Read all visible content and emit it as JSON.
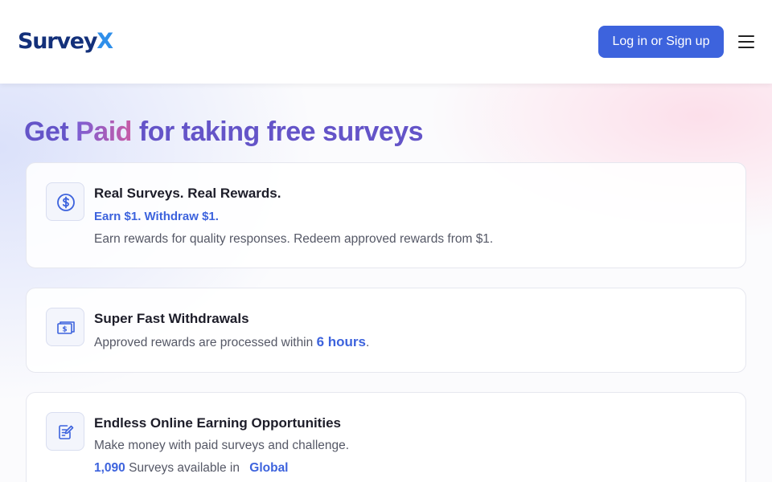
{
  "header": {
    "logo_main": "Survey",
    "logo_x": "X",
    "login_label": "Log in or Sign up",
    "menu_icon": "hamburger-menu-icon"
  },
  "hero": {
    "headline_prefix": "Get ",
    "headline_highlight": "Paid",
    "headline_suffix": " for taking free surveys"
  },
  "cards": [
    {
      "icon": "dollar-coin-icon",
      "title": "Real Surveys. Real Rewards.",
      "subtitle": "Earn $1. Withdraw $1.",
      "text": "Earn rewards for quality responses. Redeem approved rewards from $1."
    },
    {
      "icon": "banknote-icon",
      "title": "Super Fast Withdrawals",
      "text_prefix": "Approved rewards are processed within ",
      "text_highlight": "6 hours",
      "text_suffix": "."
    },
    {
      "icon": "edit-document-icon",
      "title": "Endless Online Earning Opportunities",
      "text": "Make money with paid surveys and challenge.",
      "count": "1,090",
      "count_label": " Surveys available in ",
      "region": "Global"
    }
  ],
  "colors": {
    "primary": "#3d63dd",
    "logo_dark": "#13307a",
    "logo_accent": "#2f8fea",
    "headline": "#6454c8"
  }
}
